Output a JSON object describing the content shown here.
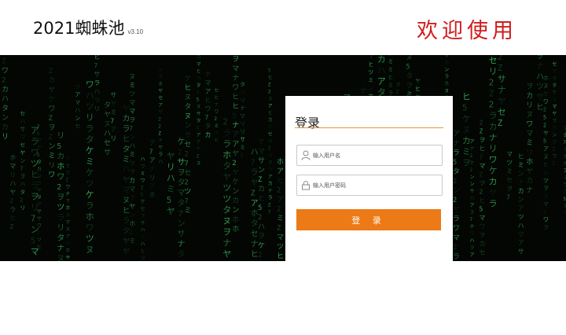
{
  "header": {
    "title": "2021蜘蛛池",
    "version": "v3.10",
    "welcome": "欢迎使用"
  },
  "login": {
    "title": "登录",
    "username_placeholder": "输入用户名",
    "password_placeholder": "输入用户密码",
    "submit_label": "登 录"
  },
  "colors": {
    "welcome": "#d11d1d",
    "accent_underline": "#e39a3a",
    "button": "#ec7a16",
    "banner_background": "#030603",
    "rain_green": "#3ec163"
  },
  "icons": {
    "username": "user-icon",
    "password": "lock-icon"
  }
}
